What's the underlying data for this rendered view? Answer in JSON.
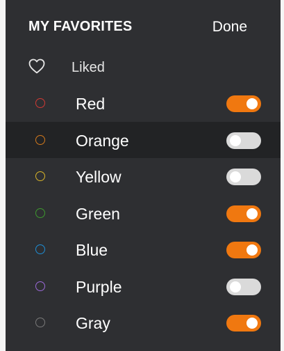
{
  "header": {
    "title": "MY FAVORITES",
    "done_label": "Done"
  },
  "liked": {
    "icon": "heart-outline-icon",
    "label": "Liked"
  },
  "colors": [
    {
      "label": "Red",
      "dot_color": "#d23a34",
      "enabled": true,
      "selected": false
    },
    {
      "label": "Orange",
      "dot_color": "#d57a1c",
      "enabled": false,
      "selected": true
    },
    {
      "label": "Yellow",
      "dot_color": "#d9b52a",
      "enabled": false,
      "selected": false
    },
    {
      "label": "Green",
      "dot_color": "#3d9a2e",
      "enabled": true,
      "selected": false
    },
    {
      "label": "Blue",
      "dot_color": "#1e8ed6",
      "enabled": true,
      "selected": false
    },
    {
      "label": "Purple",
      "dot_color": "#9b6ad9",
      "enabled": false,
      "selected": false
    },
    {
      "label": "Gray",
      "dot_color": "#7a7a7a",
      "enabled": true,
      "selected": false
    }
  ],
  "theme": {
    "panel_bg": "#2e2f32",
    "selected_row_bg": "#222325",
    "toggle_on": "#f07810",
    "toggle_off": "#dadada"
  }
}
